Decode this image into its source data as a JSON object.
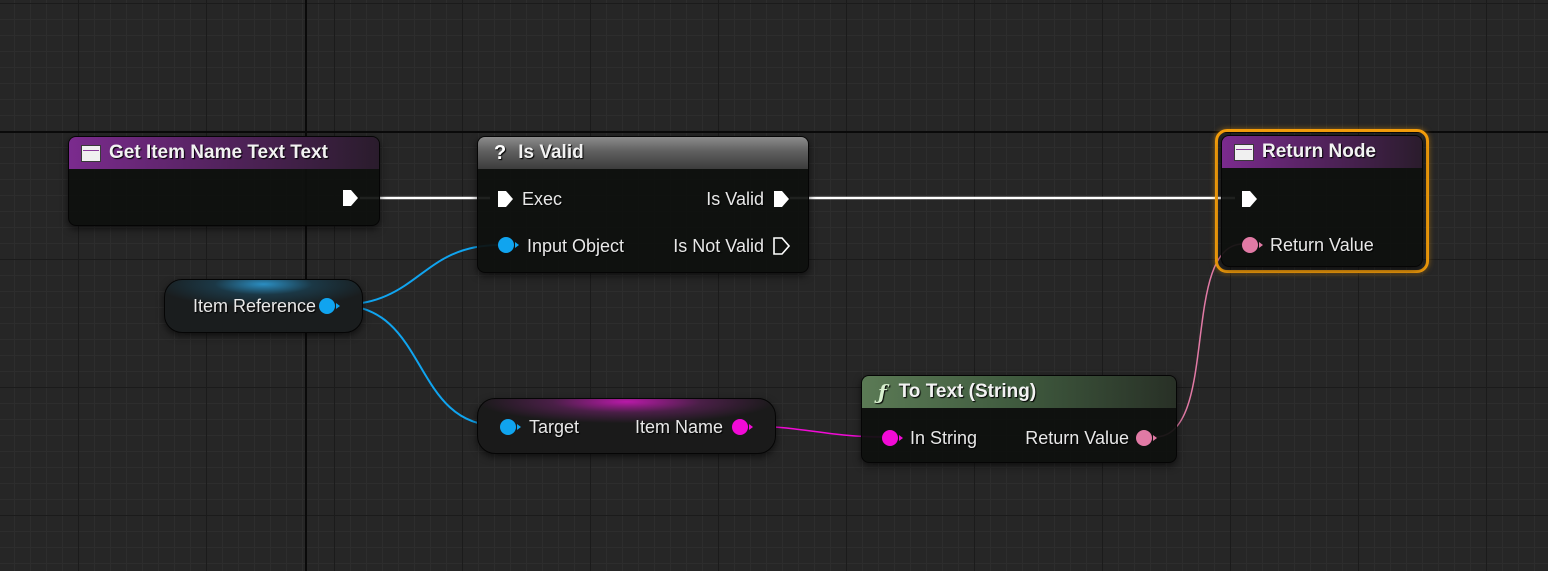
{
  "graph": {
    "nodes": {
      "entry": {
        "title": "Get Item Name Text Text"
      },
      "is_valid": {
        "title": "Is Valid",
        "pins": {
          "exec": "Exec",
          "input_object": "Input Object",
          "is_valid": "Is Valid",
          "is_not_valid": "Is Not Valid"
        }
      },
      "return_node": {
        "title": "Return Node",
        "pins": {
          "return_value": "Return Value"
        }
      },
      "item_reference": {
        "label": "Item Reference"
      },
      "get_item_name": {
        "pins": {
          "target": "Target",
          "item_name": "Item Name"
        }
      },
      "to_text": {
        "title": "To Text (String)",
        "pins": {
          "in_string": "In String",
          "return_value": "Return Value"
        }
      }
    },
    "icons": {
      "function": "function-entry-icon",
      "macro": "question-mark-icon",
      "pure_function": "f-function-icon"
    },
    "colors": {
      "exec": "#ffffff",
      "object_ref": "#10a4ef",
      "string": "#f20ad6",
      "text": "#e17aa5",
      "selection": "#f59e0b"
    }
  }
}
